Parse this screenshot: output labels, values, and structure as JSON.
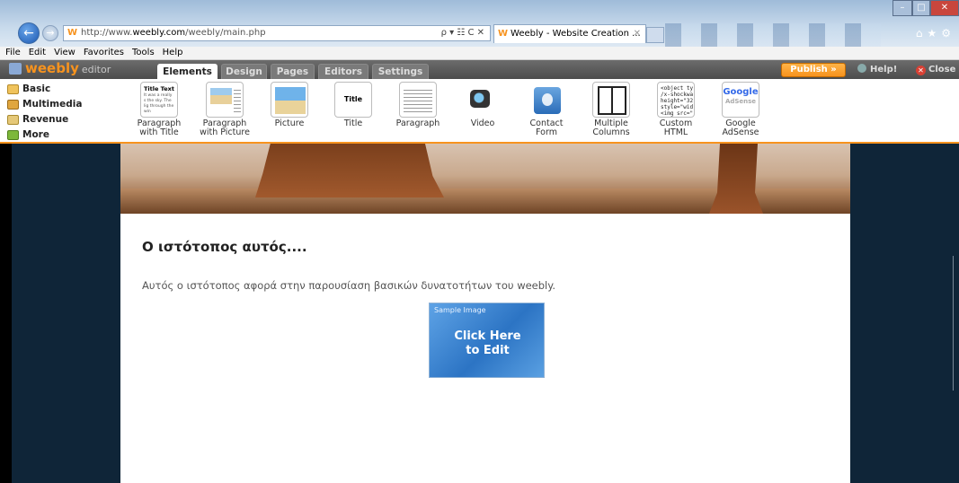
{
  "browser": {
    "address_prefix": "http://www.",
    "address_domain": "weebly.com",
    "address_path": "/weebly/main.php",
    "address_tools": "ρ ▾ ☷ C ✕",
    "tab_title": "Weebly - Website Creation ...",
    "tab_close": "✕",
    "menu": [
      "File",
      "Edit",
      "View",
      "Favorites",
      "Tools",
      "Help"
    ],
    "window_controls": {
      "minimize": "–",
      "maximize": "□",
      "close": "✕"
    },
    "right_icons": "⌂★⚙"
  },
  "weebly": {
    "logo": "weebly",
    "logo_suffix": "editor",
    "tabs": [
      {
        "label": "Elements",
        "active": true
      },
      {
        "label": "Design",
        "active": false
      },
      {
        "label": "Pages",
        "active": false
      },
      {
        "label": "Editors",
        "active": false
      },
      {
        "label": "Settings",
        "active": false
      }
    ],
    "publish_label": "Publish »",
    "help_label": "Help!",
    "close_label": "Close"
  },
  "categories": [
    "Basic",
    "Multimedia",
    "Revenue",
    "More"
  ],
  "elements": [
    {
      "label1": "Paragraph",
      "label2": "with Title",
      "thumb_title": "Title Text",
      "thumb_text": "It was a really s the sky. The lig through the win"
    },
    {
      "label1": "Paragraph",
      "label2": "with Picture"
    },
    {
      "label1": "Picture",
      "label2": ""
    },
    {
      "label1": "Title",
      "label2": "",
      "thumb_title": "Title Text"
    },
    {
      "label1": "Paragraph",
      "label2": ""
    },
    {
      "label1": "Video",
      "label2": ""
    },
    {
      "label1": "Contact",
      "label2": "Form"
    },
    {
      "label1": "Multiple",
      "label2": "Columns"
    },
    {
      "label1": "Custom",
      "label2": "HTML",
      "thumb_code": "<object ty\n/x-shockwa\nheight=\"32\nstyle=\"wid\n<img src=\"\ntarget=\"_b"
    },
    {
      "label1": "Google",
      "label2": "AdSense",
      "thumb_title": "Google",
      "thumb_sub": "AdSense"
    }
  ],
  "page": {
    "heading": "Ο ιστότοπος αυτός....",
    "paragraph": "Αυτός ο ιστότοπος αφορά στην παρουσίαση βασικών δυνατοτήτων του weebly.",
    "sample_label": "Sample Image",
    "sample_line1": "Click Here",
    "sample_line2": "to Edit"
  }
}
